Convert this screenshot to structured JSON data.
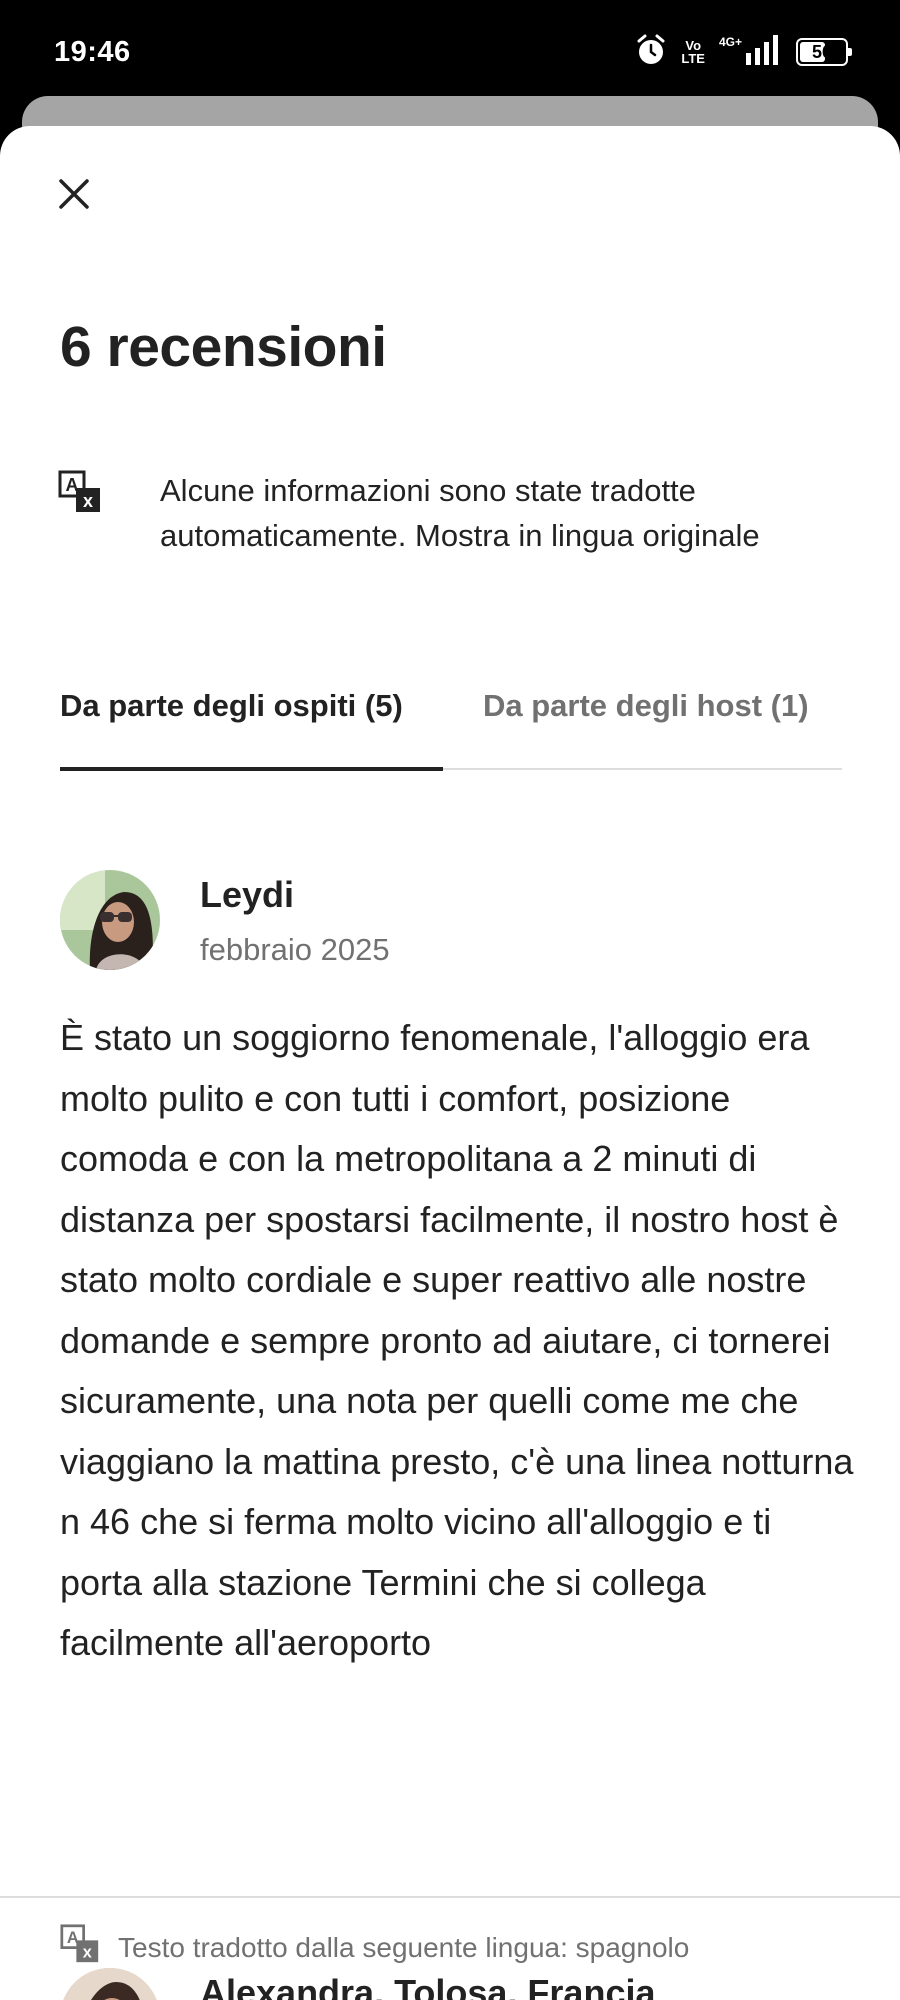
{
  "status_bar": {
    "time": "19:46",
    "volte_top": "Vo",
    "volte_bottom": "LTE",
    "network": "4G+",
    "battery_level": "56"
  },
  "sheet": {
    "title": "6 recensioni",
    "translation_notice": "Alcune informazioni sono state tradotte automaticamente. Mostra in lingua originale",
    "tabs": [
      {
        "label": "Da parte degli ospiti (5)",
        "selected": true
      },
      {
        "label": "Da parte degli host (1)",
        "selected": false
      }
    ]
  },
  "reviews": [
    {
      "name": "Leydi",
      "date": "febbraio 2025",
      "text": "È stato un soggiorno fenomenale, l'alloggio era molto pulito e con tutti i comfort, posizione comoda e con la metropolitana a 2 minuti di distanza per spostarsi facilmente, il nostro host è stato molto cordiale e super reattivo alle nostre domande e sempre pronto ad aiutare, ci tornerei sicuramente, una nota per quelli come me che viaggiano la mattina presto, c'è una linea notturna n 46 che si ferma molto vicino all'alloggio e ti porta alla stazione Termini che si collega facilmente all'aeroporto",
      "translated_note": "Testo tradotto dalla seguente lingua: spagnolo"
    },
    {
      "name": "Alexandra, Tolosa, Francia"
    }
  ],
  "colors": {
    "text_primary": "#222222",
    "text_secondary": "#717171",
    "divider": "#dddddd"
  },
  "icons": {
    "close": "close-icon",
    "translate": "translate-icon",
    "alarm": "alarm-icon",
    "signal": "signal-icon",
    "battery": "battery-icon"
  }
}
